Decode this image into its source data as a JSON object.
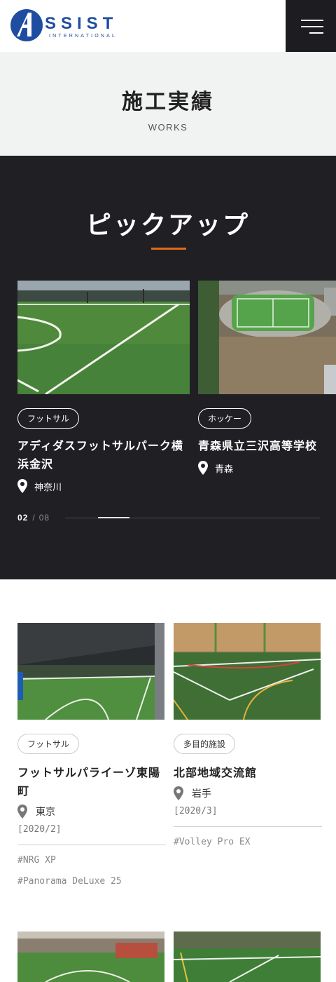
{
  "header": {
    "logo_text": "SSIST",
    "logo_sub": "INTERNATIONAL",
    "colors": {
      "brand": "#1e4da1",
      "menu_bg": "#1d1d21"
    }
  },
  "page": {
    "title": "施工実績",
    "subtitle": "WORKS"
  },
  "pickup": {
    "title": "ピックアップ",
    "accent": "#e06a1d",
    "cards": [
      {
        "tag": "フットサル",
        "name": "アディダスフットサルパーク横浜金沢",
        "location": "神奈川"
      },
      {
        "tag": "ホッケー",
        "name": "青森県立三沢高等学校",
        "location": "青森"
      }
    ],
    "pager": {
      "current": "02",
      "separator": "/",
      "total": "08"
    }
  },
  "works": [
    {
      "tag": "フットサル",
      "name": "フットサルパライーゾ東陽町",
      "location": "東京",
      "date": "[2020/2]",
      "hashtags": [
        "#NRG XP",
        "#Panorama DeLuxe 25"
      ]
    },
    {
      "tag": "多目的施設",
      "name": "北部地域交流館",
      "location": "岩手",
      "date": "[2020/3]",
      "hashtags": [
        "#Volley Pro EX"
      ]
    }
  ]
}
